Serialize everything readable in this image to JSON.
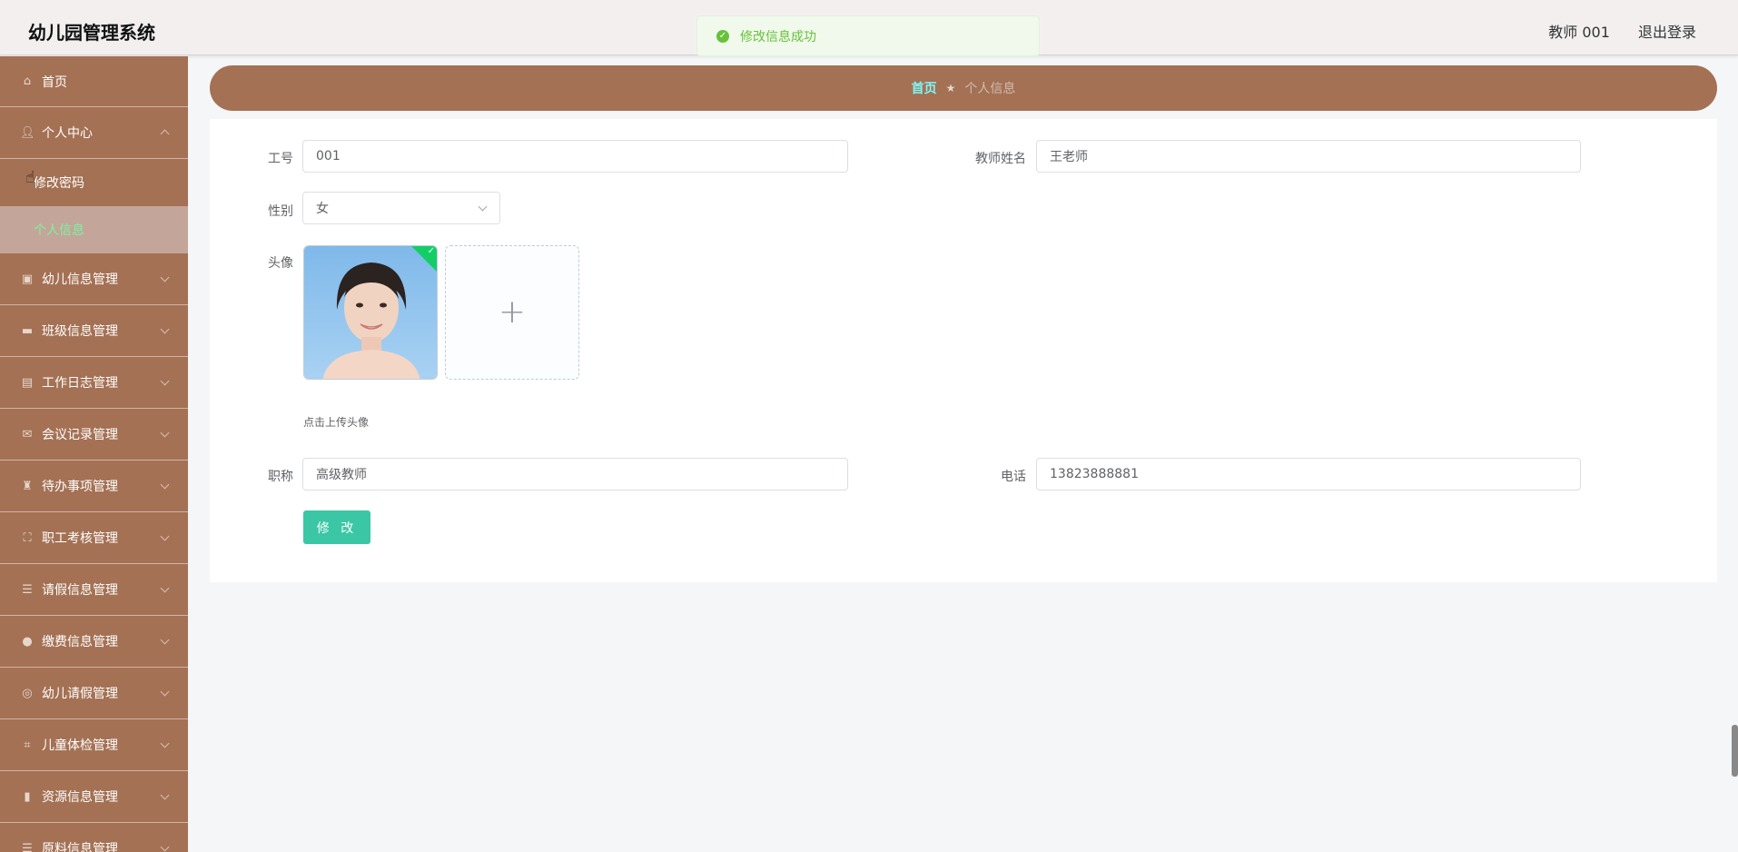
{
  "header": {
    "app_title": "幼儿园管理系统",
    "user_label": "教师 001",
    "logout_label": "退出登录"
  },
  "toast": {
    "message": "修改信息成功",
    "status_color": "#67c23a"
  },
  "sidebar": {
    "items": [
      {
        "label": "首页",
        "icon": "home-icon"
      },
      {
        "label": "个人中心",
        "icon": "user-icon",
        "expanded": true,
        "children": [
          {
            "label": "修改密码"
          },
          {
            "label": "个人信息",
            "active": true
          }
        ]
      },
      {
        "label": "幼儿信息管理",
        "icon": "clipboard-icon"
      },
      {
        "label": "班级信息管理",
        "icon": "ticket-icon"
      },
      {
        "label": "工作日志管理",
        "icon": "notebook-icon"
      },
      {
        "label": "会议记录管理",
        "icon": "mail-icon"
      },
      {
        "label": "待办事项管理",
        "icon": "trophy-icon"
      },
      {
        "label": "职工考核管理",
        "icon": "frame-icon"
      },
      {
        "label": "请假信息管理",
        "icon": "list-icon"
      },
      {
        "label": "缴费信息管理",
        "icon": "mic-icon"
      },
      {
        "label": "幼儿请假管理",
        "icon": "compass-icon"
      },
      {
        "label": "儿童体检管理",
        "icon": "crop-icon"
      },
      {
        "label": "资源信息管理",
        "icon": "bar-chart-icon"
      },
      {
        "label": "原料信息管理",
        "icon": "list-icon"
      }
    ],
    "bg_color": "#a47154"
  },
  "breadcrumb": {
    "home": "首页",
    "current": "个人信息"
  },
  "form": {
    "job_no": {
      "label": "工号",
      "value": "001"
    },
    "teacher_name": {
      "label": "教师姓名",
      "value": "王老师"
    },
    "gender": {
      "label": "性别",
      "value": "女"
    },
    "avatar": {
      "label": "头像",
      "hint": "点击上传头像",
      "upload_icon": "plus-icon"
    },
    "title": {
      "label": "职称",
      "value": "高级教师"
    },
    "phone": {
      "label": "电话",
      "value": "13823888881"
    },
    "submit_label": "修 改",
    "accent_color": "#3bc7a6"
  }
}
